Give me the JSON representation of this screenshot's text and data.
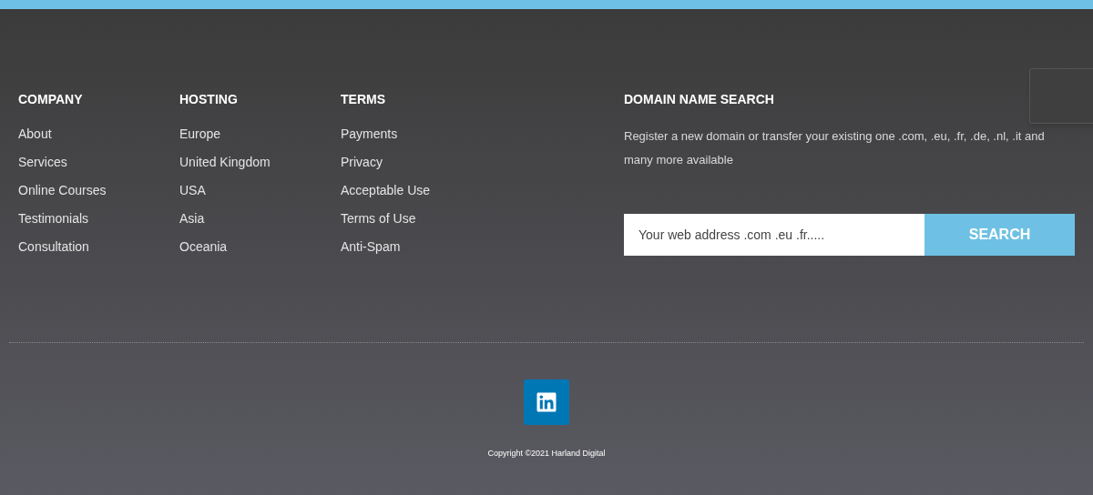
{
  "columns": [
    {
      "heading": "COMPANY",
      "links": [
        "About",
        "Services",
        "Online Courses",
        "Testimonials",
        "Consultation"
      ]
    },
    {
      "heading": "HOSTING",
      "links": [
        "Europe",
        "United Kingdom",
        "USA",
        "Asia",
        "Oceania"
      ]
    },
    {
      "heading": "TERMS",
      "links": [
        "Payments",
        "Privacy",
        "Acceptable Use",
        "Terms of Use",
        "Anti-Spam"
      ]
    }
  ],
  "domain_search": {
    "heading": "DOMAIN NAME SEARCH",
    "description": "Register a new domain or transfer your existing one .com, .eu, .fr, .de, .nl, .it and many more available",
    "placeholder": "Your web address .com .eu .fr.....",
    "button": "SEARCH"
  },
  "copyright": "Copyright ©2021 Harland Digital"
}
